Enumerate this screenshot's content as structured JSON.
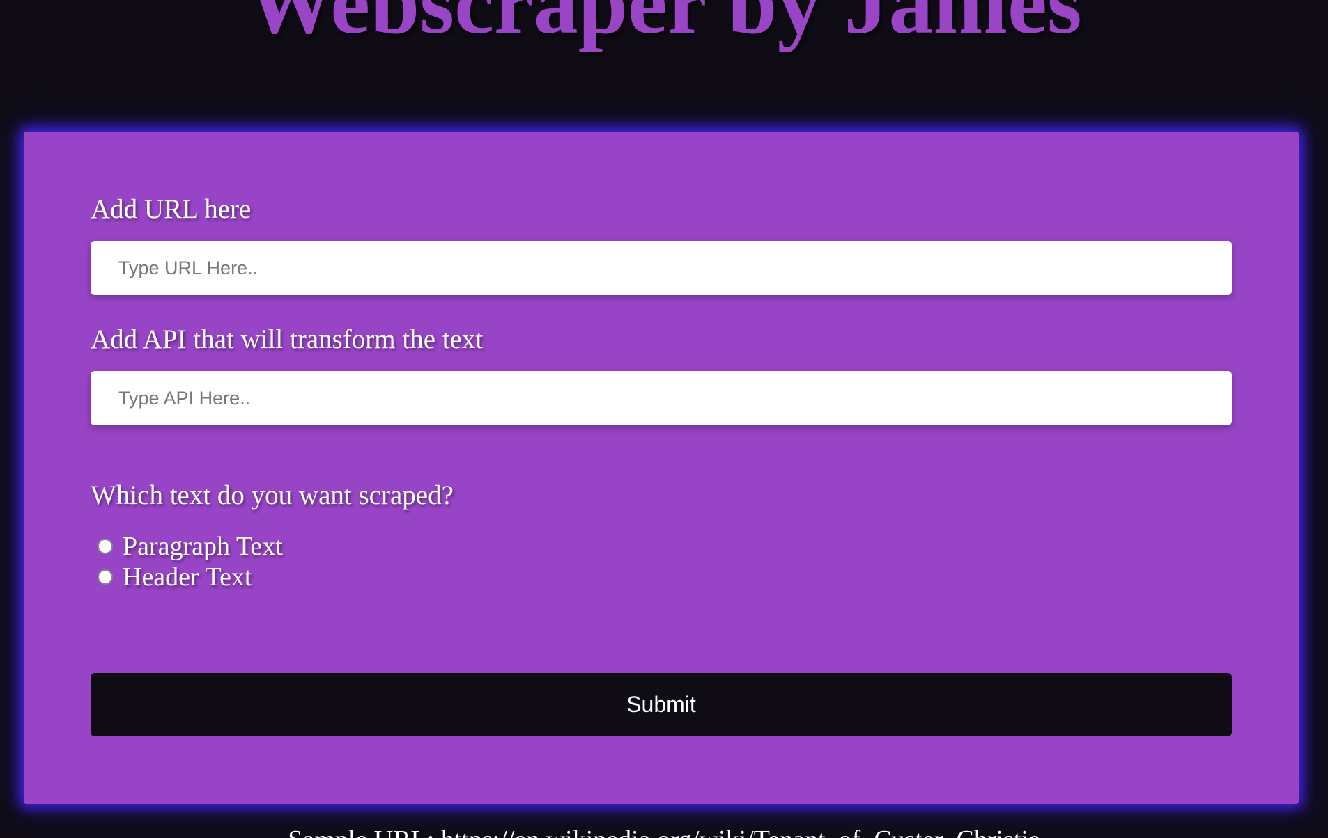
{
  "header": {
    "title": "Webscraper by James"
  },
  "form": {
    "url_label": "Add URL here",
    "url_placeholder": "Type URL Here..",
    "url_value": "",
    "api_label": "Add API that will transform the text",
    "api_placeholder": "Type API Here..",
    "api_value": "",
    "question": "Which text do you want scraped?",
    "options": [
      {
        "label": "Paragraph Text",
        "selected": false
      },
      {
        "label": "Header Text",
        "selected": false
      }
    ],
    "submit_label": "Submit"
  },
  "footer": {
    "note": "Sample URL: https://en.wikipedia.org/wiki/Tenant_of_Custer_Christie"
  },
  "colors": {
    "background": "#0f0c16",
    "card": "#9844c6",
    "title": "#9a44c6",
    "glow": "#4628ff",
    "button": "#0f0c16"
  }
}
